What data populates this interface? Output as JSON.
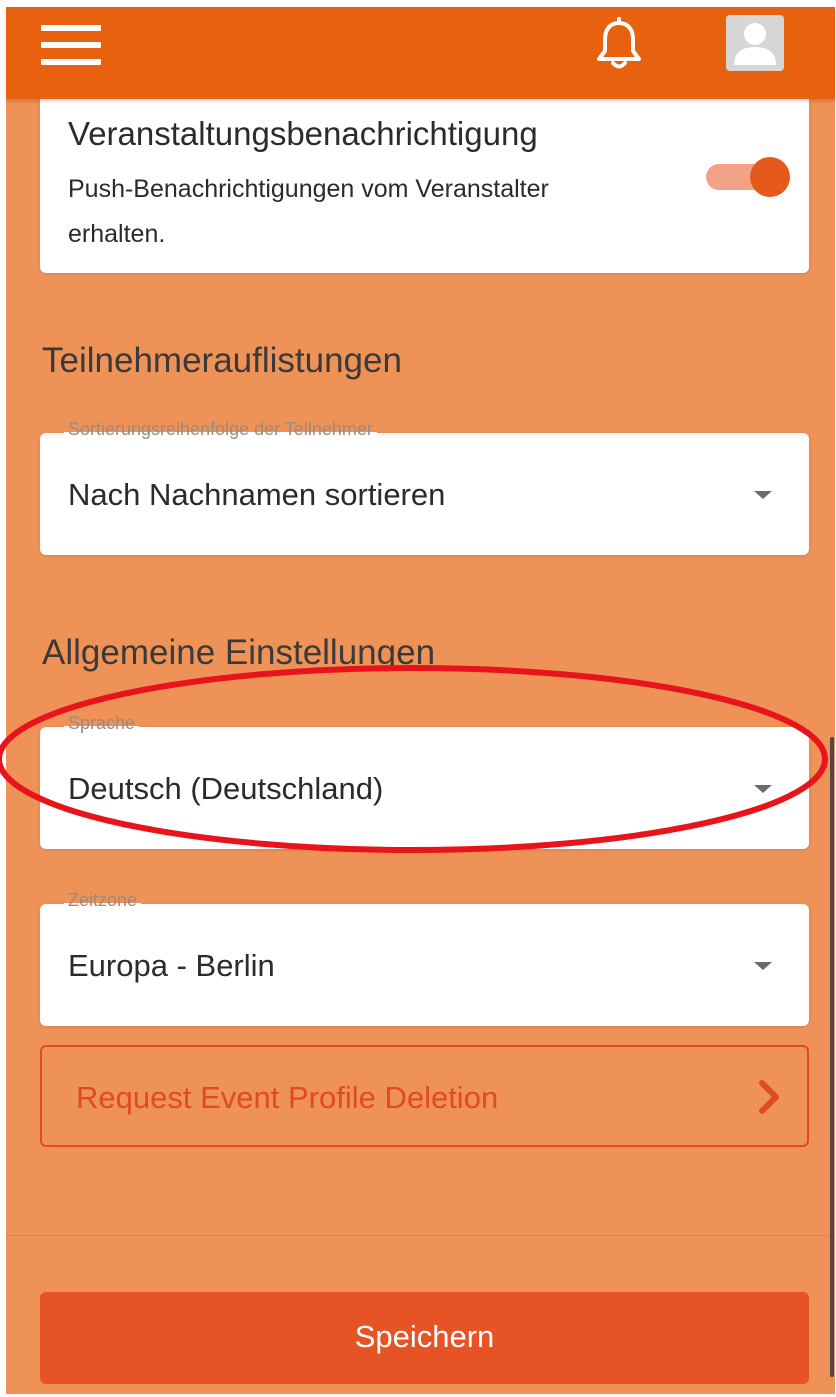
{
  "header": {
    "menu_icon": "hamburger-menu-icon",
    "notification_icon": "bell-icon",
    "profile_icon": "user-avatar-icon",
    "color": "#e8610f"
  },
  "event_notification": {
    "title": "Veranstaltungsbenachrichtigung",
    "description": "Push-Benachrichtigungen vom Veranstalter erhalten.",
    "toggle_on": true,
    "toggle_color": "#e55a1c"
  },
  "attendee_listings": {
    "section_title": "Teilnehmerauflistungen",
    "sort_label": "Sortierungsreihenfolge der Teilnehmer",
    "sort_value": "Nach Nachnamen sortieren"
  },
  "general_settings": {
    "section_title": "Allgemeine Einstellungen",
    "language_label": "Sprache",
    "language_value": "Deutsch (Deutschland)",
    "timezone_label": "Zeitzone",
    "timezone_value": "Europa - Berlin"
  },
  "delete_profile": {
    "label": "Request Event Profile Deletion",
    "icon": "chevron-right-icon",
    "color": "#e04a27"
  },
  "save": {
    "label": "Speichern",
    "color": "#e65425"
  },
  "annotation": {
    "shape": "ellipse",
    "color": "#e8141b",
    "highlights": "language-select"
  },
  "colors": {
    "background": "#ee9257"
  }
}
